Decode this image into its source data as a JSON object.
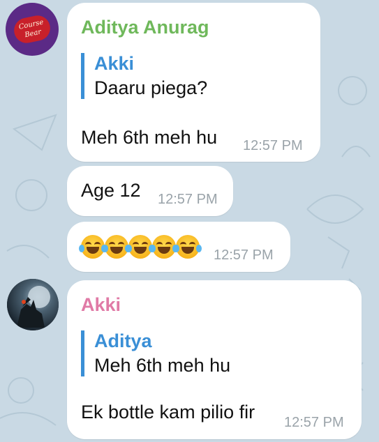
{
  "colors": {
    "background": "#c9d9e4",
    "bubble": "#ffffff",
    "sender1": "#6fb85b",
    "sender2": "#e07aa6",
    "quote_name": "#3a8fd6",
    "time": "#9aa3a9"
  },
  "messages": [
    {
      "sender": "Aditya Anurag",
      "avatar_badge": "Course Bear",
      "reply_to": {
        "name": "Akki",
        "text": "Daaru piega?"
      },
      "text": "Meh 6th meh hu",
      "time": "12:57 PM"
    },
    {
      "text": "Age 12",
      "time": "12:57 PM"
    },
    {
      "emoji": "face-with-tears-of-joy x5",
      "time": "12:57 PM"
    },
    {
      "sender": "Akki",
      "reply_to": {
        "name": "Aditya",
        "text": "Meh 6th meh hu"
      },
      "text": "Ek bottle kam pilio fir",
      "time": "12:57 PM"
    }
  ]
}
